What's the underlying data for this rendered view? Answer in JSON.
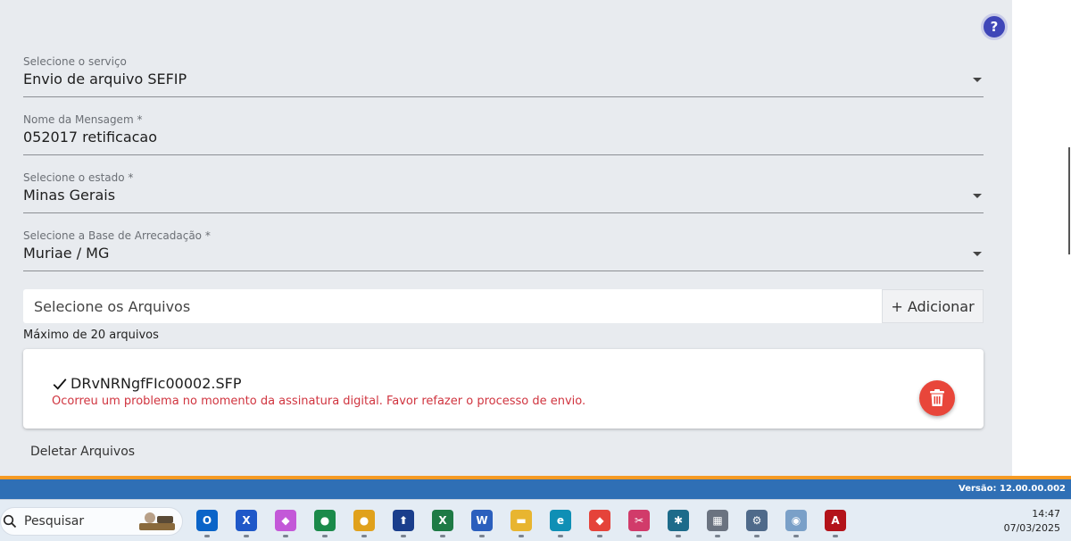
{
  "help": {
    "label": "?"
  },
  "form": {
    "service": {
      "label": "Selecione o serviço",
      "value": "Envio de arquivo SEFIP"
    },
    "message_name": {
      "label": "Nome da Mensagem *",
      "value": "052017 retificacao"
    },
    "state": {
      "label": "Selecione o estado *",
      "value": "Minas Gerais"
    },
    "base": {
      "label": "Selecione a Base de Arrecadação *",
      "value": "Muriae / MG"
    }
  },
  "files": {
    "placeholder": "Selecione os Arquivos",
    "add_label": "+ Adicionar",
    "max_note": "Máximo de 20 arquivos",
    "items": [
      {
        "name": "DRvNRNgfFIc00002.SFP",
        "error": "Ocorreu um problema no momento da assinatura digital. Favor refazer o processo de envio."
      }
    ],
    "delete_all_label": "Deletar Arquivos"
  },
  "status_bar": {
    "version": "Versão: 12.00.00.002"
  },
  "taskbar": {
    "search_label": "Pesquisar",
    "apps": [
      {
        "name": "outlook-icon",
        "glyph": "O",
        "color": "#0a64c8"
      },
      {
        "name": "app-x-icon",
        "glyph": "X",
        "color": "#1f58c8"
      },
      {
        "name": "copilot-icon",
        "glyph": "◆",
        "color": "#c358d8"
      },
      {
        "name": "contacts-icon",
        "glyph": "●",
        "color": "#1b8a4a"
      },
      {
        "name": "chrome-icon",
        "glyph": "●",
        "color": "#e0a11c"
      },
      {
        "name": "upload-icon",
        "glyph": "⬆",
        "color": "#1a3e8c"
      },
      {
        "name": "excel-icon",
        "glyph": "X",
        "color": "#1e7a45"
      },
      {
        "name": "word-icon",
        "glyph": "W",
        "color": "#2b5fbd"
      },
      {
        "name": "file-explorer-icon",
        "glyph": "▬",
        "color": "#e8b530"
      },
      {
        "name": "edge-icon",
        "glyph": "e",
        "color": "#0f8fb5"
      },
      {
        "name": "anydesk-icon",
        "glyph": "◆",
        "color": "#e5433a"
      },
      {
        "name": "snipping-tool-icon",
        "glyph": "✂",
        "color": "#d13b6a"
      },
      {
        "name": "butterfly-app-icon",
        "glyph": "✱",
        "color": "#1d6b8a"
      },
      {
        "name": "calculator-icon",
        "glyph": "▦",
        "color": "#6b7380"
      },
      {
        "name": "settings-icon",
        "glyph": "⚙",
        "color": "#4f6a8a"
      },
      {
        "name": "globe-app-icon",
        "glyph": "◉",
        "color": "#7aa0c8"
      },
      {
        "name": "acrobat-icon",
        "glyph": "A",
        "color": "#b3131a"
      }
    ],
    "time": "14:47",
    "date": "07/03/2025"
  }
}
